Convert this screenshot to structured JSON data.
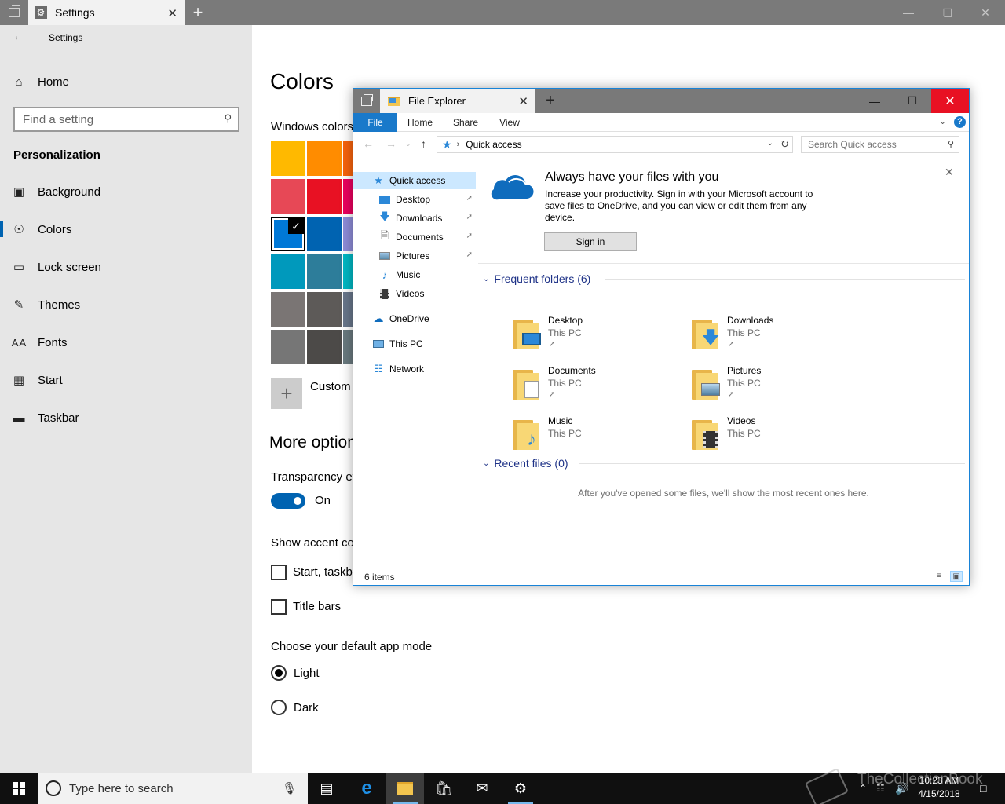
{
  "settings": {
    "tab_title": "Settings",
    "app_title": "Settings",
    "search_placeholder": "Find a setting",
    "nav_home": "Home",
    "section": "Personalization",
    "nav": [
      {
        "label": "Background",
        "icon": "picture-icon"
      },
      {
        "label": "Colors",
        "icon": "palette-icon"
      },
      {
        "label": "Lock screen",
        "icon": "lock-screen-icon"
      },
      {
        "label": "Themes",
        "icon": "brush-icon"
      },
      {
        "label": "Fonts",
        "icon": "font-icon"
      },
      {
        "label": "Start",
        "icon": "start-icon"
      },
      {
        "label": "Taskbar",
        "icon": "taskbar-icon"
      }
    ],
    "page_title": "Colors",
    "windows_colors_label": "Windows colors",
    "swatch_rows": [
      [
        "#FFB900",
        "#FF8C00",
        "#F7630C"
      ],
      [
        "#E74856",
        "#E81123",
        "#EA005E"
      ],
      [
        "#0078D7",
        "#0063B1",
        "#8E8CD8"
      ],
      [
        "#0099BC",
        "#2D7D9A",
        "#00B7C3"
      ],
      [
        "#7A7574",
        "#5D5A58",
        "#68768A"
      ],
      [
        "#767676",
        "#4C4A48",
        "#69797E"
      ]
    ],
    "selected_swatch": "#0078D7",
    "custom_label": "Custom",
    "more_options": "More option",
    "transparency_label": "Transparency ef",
    "transparency_state": "On",
    "accent_label": "Show accent co",
    "start_taskbar_label": "Start, taskba",
    "title_bars_label": "Title bars",
    "app_mode_label": "Choose your default app mode",
    "mode_light": "Light",
    "mode_dark": "Dark"
  },
  "explorer": {
    "tab_title": "File Explorer",
    "ribbon": {
      "file": "File",
      "home": "Home",
      "share": "Share",
      "view": "View"
    },
    "address": "Quick access",
    "search_placeholder": "Search Quick access",
    "nav": {
      "quick_access": "Quick access",
      "desktop": "Desktop",
      "downloads": "Downloads",
      "documents": "Documents",
      "pictures": "Pictures",
      "music": "Music",
      "videos": "Videos",
      "onedrive": "OneDrive",
      "this_pc": "This PC",
      "network": "Network"
    },
    "onedrive": {
      "title": "Always have your files with you",
      "body": "Increase your productivity. Sign in with your Microsoft account to save files to OneDrive, and you can view or edit them from any device.",
      "sign_in": "Sign in"
    },
    "frequent_header": "Frequent folders (6)",
    "folders": [
      {
        "name": "Desktop",
        "location": "This PC"
      },
      {
        "name": "Downloads",
        "location": "This PC"
      },
      {
        "name": "Documents",
        "location": "This PC"
      },
      {
        "name": "Pictures",
        "location": "This PC"
      },
      {
        "name": "Music",
        "location": "This PC"
      },
      {
        "name": "Videos",
        "location": "This PC"
      }
    ],
    "recent_header": "Recent files (0)",
    "recent_empty": "After you've opened some files, we'll show the most recent ones here.",
    "status_count": "6 items"
  },
  "taskbar": {
    "search_placeholder": "Type here to search",
    "time": "10:23 AM",
    "date": "4/15/2018"
  },
  "watermark": "TheCollectionBook",
  "colors": {
    "accent": "#0063B1",
    "close_red": "#E81123",
    "selection": "#CCE8FF"
  }
}
